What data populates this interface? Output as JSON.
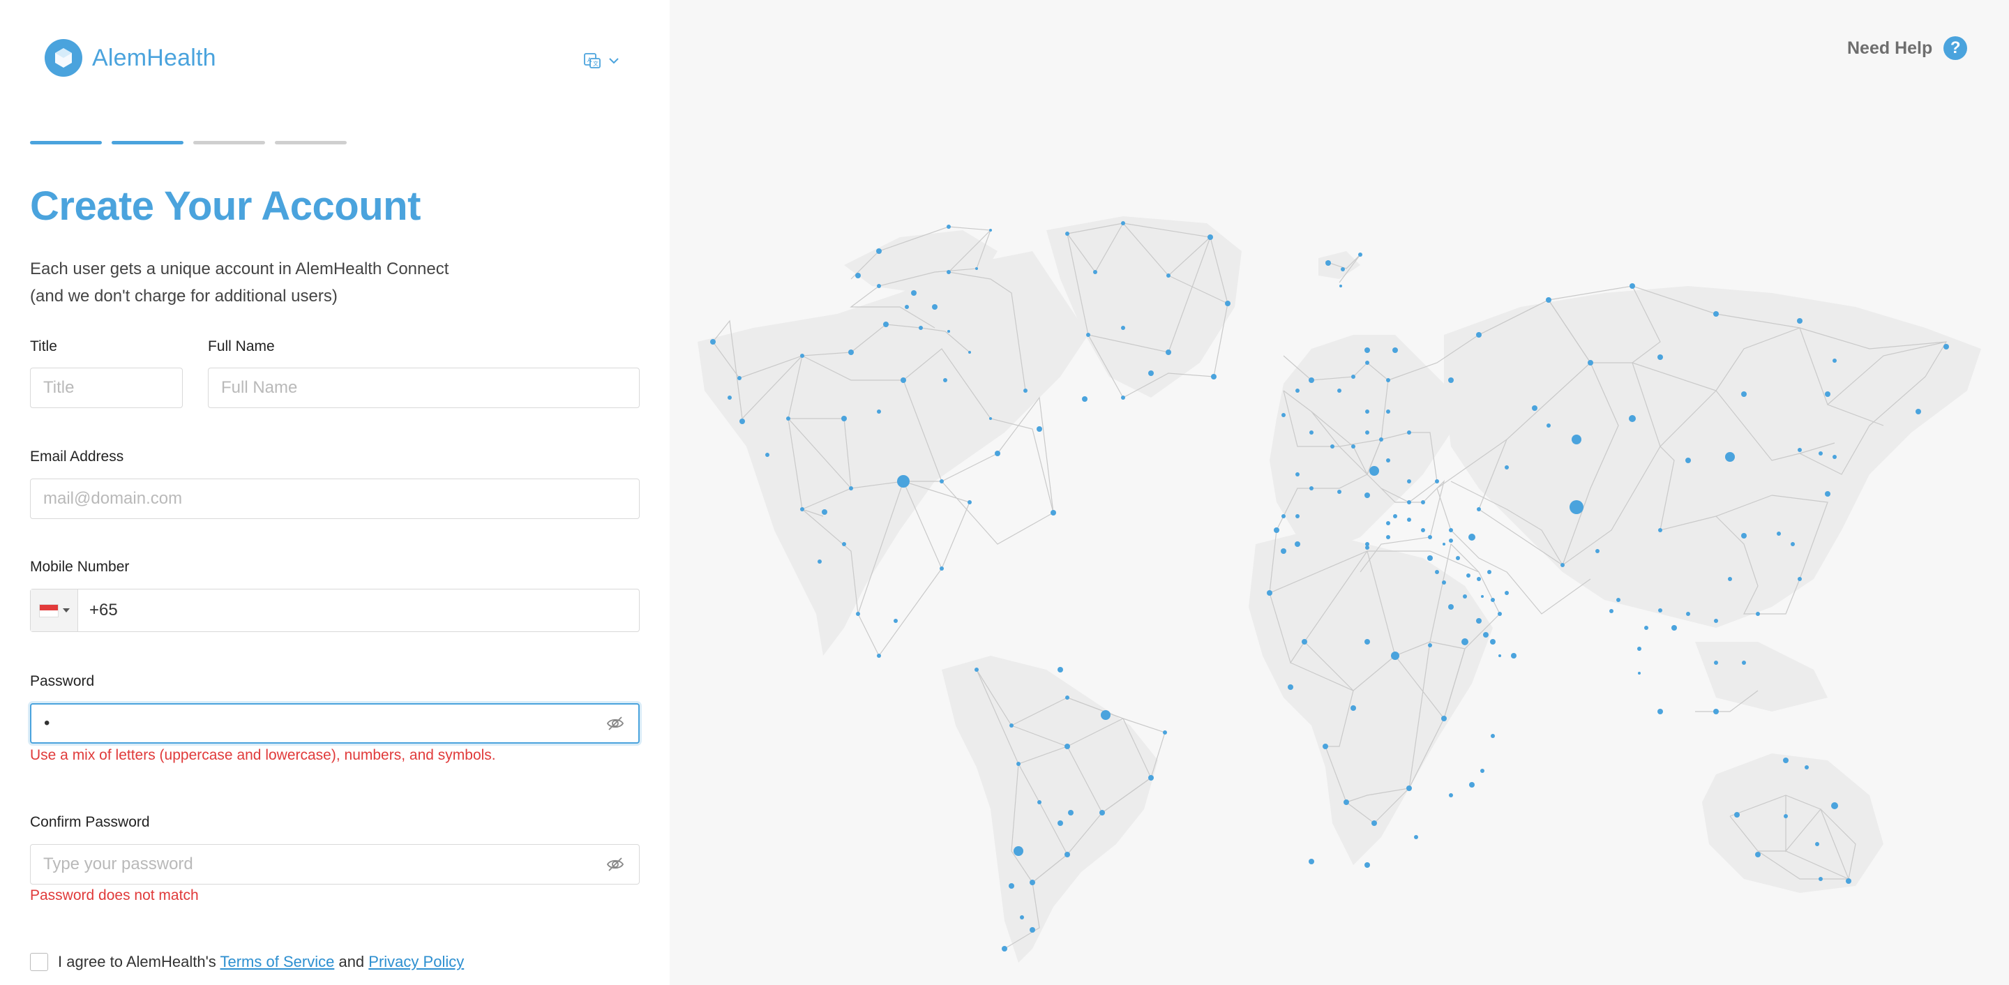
{
  "brand": {
    "name": "AlemHealth",
    "accent": "#4aa3dd"
  },
  "language_selector": {
    "icon": "translate-icon"
  },
  "progress": {
    "total_steps": 4,
    "current_step": 2
  },
  "form": {
    "heading": "Create Your Account",
    "subtitle_line1": "Each user gets a unique account in AlemHealth Connect",
    "subtitle_line2": "(and we don't charge for additional users)",
    "title_label": "Title",
    "title_placeholder": "Title",
    "fullname_label": "Full Name",
    "fullname_placeholder": "Full Name",
    "email_label": "Email Address",
    "email_placeholder": "mail@domain.com",
    "mobile_label": "Mobile Number",
    "mobile_value": "+65",
    "country_flag": "singapore-flag",
    "password_label": "Password",
    "password_value": "•",
    "password_error": "Use a mix of letters (uppercase and lowercase), numbers, and symbols.",
    "confirm_label": "Confirm Password",
    "confirm_placeholder": "Type your password",
    "confirm_error": "Password does not match",
    "terms_prefix": "I agree to AlemHealth's",
    "terms_link": "Terms of Service",
    "terms_and": "and",
    "privacy_link": "Privacy Policy",
    "error_color": "#e03a3a"
  },
  "help": {
    "label": "Need Help",
    "icon_glyph": "?"
  }
}
